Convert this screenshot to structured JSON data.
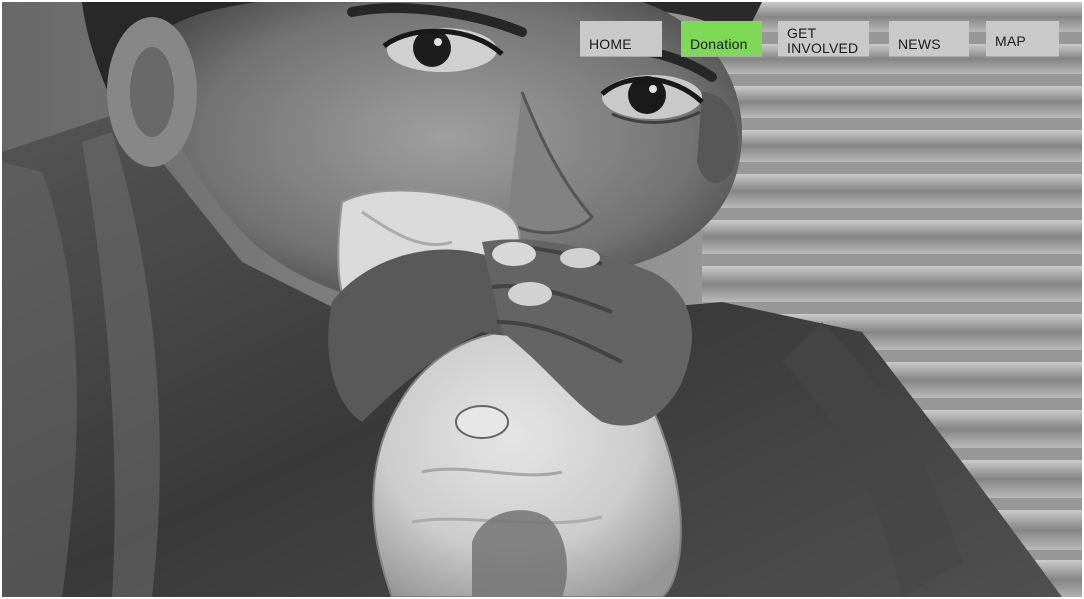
{
  "nav": {
    "items": [
      {
        "label": "HOME",
        "active": false
      },
      {
        "label": "Donation",
        "active": true
      },
      {
        "label": "GET\nINVOLVED",
        "active": false
      },
      {
        "label": "NEWS",
        "active": false
      },
      {
        "label": "MAP",
        "active": false
      }
    ]
  },
  "colors": {
    "nav_bg": "#c9c9c9",
    "nav_active_bg": "#7ed957",
    "nav_text": "#1a1a1a"
  }
}
